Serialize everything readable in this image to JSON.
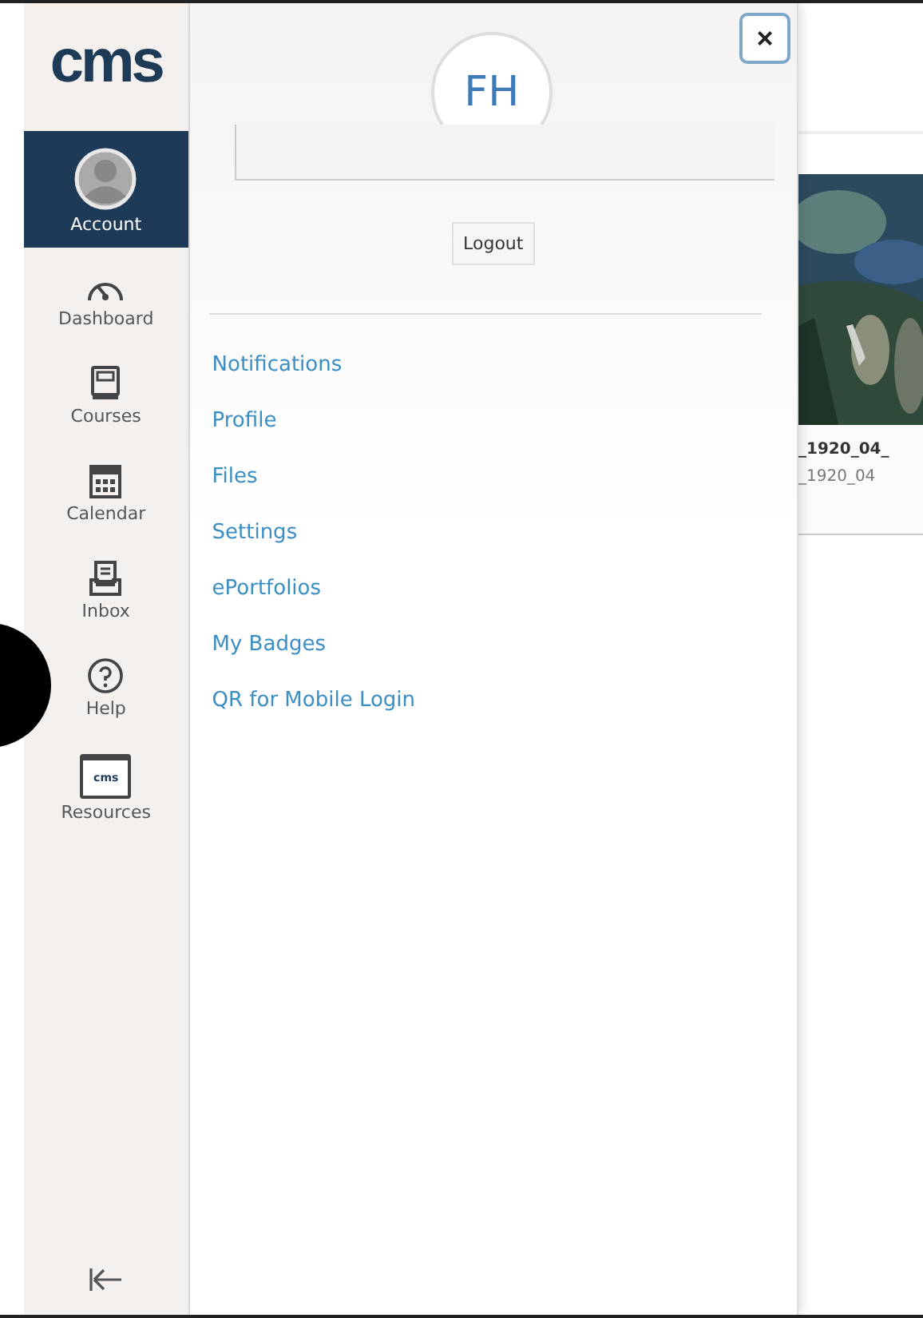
{
  "logo": {
    "text": "cms"
  },
  "nav": [
    {
      "label": "Account",
      "kind": "avatar",
      "selected": true
    },
    {
      "label": "Dashboard",
      "kind": "gauge",
      "selected": false
    },
    {
      "label": "Courses",
      "kind": "book",
      "selected": false
    },
    {
      "label": "Calendar",
      "kind": "calendar",
      "selected": false
    },
    {
      "label": "Inbox",
      "kind": "inbox",
      "selected": false
    },
    {
      "label": "Help",
      "kind": "help",
      "selected": false
    },
    {
      "label": "Resources",
      "kind": "folder",
      "icon_text": "cms",
      "selected": false
    }
  ],
  "tray": {
    "close": "×",
    "initials": "FH",
    "logout": "Logout",
    "links": [
      "Notifications",
      "Profile",
      "Files",
      "Settings",
      "ePortfolios",
      "My Badges",
      "QR for Mobile Login"
    ]
  },
  "content": {
    "card": {
      "kind": "picture",
      "title": "_1920_04_",
      "subtitle": "_1920_04"
    }
  }
}
